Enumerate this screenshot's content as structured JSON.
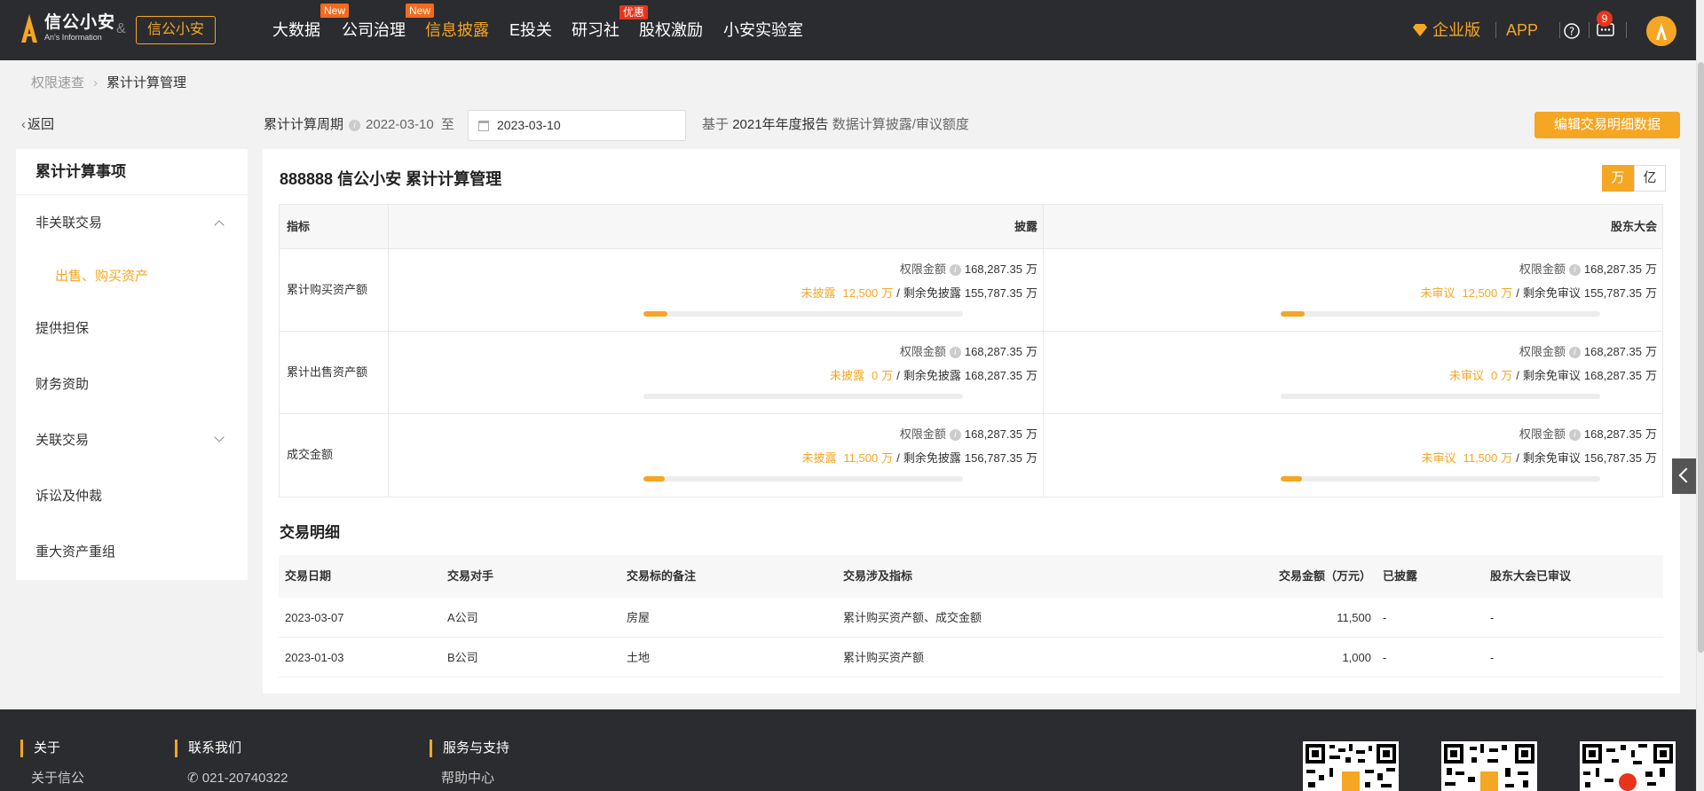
{
  "brand": {
    "title": "信公小安",
    "subtitle": "An's Information",
    "amp": "&",
    "partner": "信公小安"
  },
  "nav": {
    "items": [
      {
        "label": "大数据",
        "badge": "New"
      },
      {
        "label": "公司治理",
        "badge": "New"
      },
      {
        "label": "信息披露",
        "badge": ""
      },
      {
        "label": "E投关",
        "badge": ""
      },
      {
        "label": "研习社",
        "badge": "优惠"
      },
      {
        "label": "股权激励",
        "badge": ""
      },
      {
        "label": "小安实验室",
        "badge": ""
      }
    ],
    "enterprise": "企业版",
    "app": "APP",
    "notifications": "9"
  },
  "breadcrumb": {
    "parent": "权限速查",
    "current": "累计计算管理"
  },
  "back_label": "返回",
  "sidebar": {
    "title": "累计计算事项",
    "items": [
      "非关联交易",
      "提供担保",
      "财务资助",
      "关联交易",
      "诉讼及仲裁",
      "重大资产重组"
    ],
    "sub_item": "出售、购买资产"
  },
  "filter": {
    "period_label": "累计计算周期",
    "start_date": "2022-03-10",
    "to": "至",
    "end_date": "2023-03-10",
    "basis_prefix": "基于",
    "basis_report": "2021年年度报告",
    "basis_suffix": "数据计算披露/审议额度",
    "edit_button": "编辑交易明细数据"
  },
  "panel": {
    "title": "888888 信公小安 累计计算管理",
    "unit_wan": "万",
    "unit_yi": "亿",
    "headers": {
      "indicator": "指标",
      "disclosure": "披露",
      "meeting": "股东大会"
    },
    "limit_label": "权限金额",
    "unit": "万",
    "sep": "/",
    "rows": [
      {
        "label": "累计购买资产额",
        "disclosure": {
          "limit": "168,287.35",
          "used_label": "未披露",
          "used": "12,500",
          "remain_label": "剩余免披露",
          "remain": "155,787.35",
          "fill": 0.074
        },
        "meeting": {
          "limit": "168,287.35",
          "used_label": "未审议",
          "used": "12,500",
          "remain_label": "剩余免审议",
          "remain": "155,787.35",
          "fill": 0.074
        }
      },
      {
        "label": "累计出售资产额",
        "disclosure": {
          "limit": "168,287.35",
          "used_label": "未披露",
          "used": "0",
          "remain_label": "剩余免披露",
          "remain": "168,287.35",
          "fill": 0
        },
        "meeting": {
          "limit": "168,287.35",
          "used_label": "未审议",
          "used": "0",
          "remain_label": "剩余免审议",
          "remain": "168,287.35",
          "fill": 0
        }
      },
      {
        "label": "成交金额",
        "disclosure": {
          "limit": "168,287.35",
          "used_label": "未披露",
          "used": "11,500",
          "remain_label": "剩余免披露",
          "remain": "156,787.35",
          "fill": 0.068
        },
        "meeting": {
          "limit": "168,287.35",
          "used_label": "未审议",
          "used": "11,500",
          "remain_label": "剩余免审议",
          "remain": "156,787.35",
          "fill": 0.068
        }
      }
    ]
  },
  "transactions": {
    "title": "交易明细",
    "headers": [
      "交易日期",
      "交易对手",
      "交易标的备注",
      "交易涉及指标",
      "交易金额（万元）",
      "已披露",
      "股东大会已审议"
    ],
    "rows": [
      [
        "2023-03-07",
        "A公司",
        "房屋",
        "累计购买资产额、成交金额",
        "11,500",
        "-",
        "-"
      ],
      [
        "2023-01-03",
        "B公司",
        "土地",
        "累计购买资产额",
        "1,000",
        "-",
        "-"
      ]
    ]
  },
  "footer": {
    "about": {
      "title": "关于",
      "link": "关于信公"
    },
    "contact": {
      "title": "联系我们",
      "phone": "021-20740322"
    },
    "service": {
      "title": "服务与支持",
      "link": "帮助中心"
    }
  },
  "colors": {
    "accent": "#f5a623",
    "nav_bg": "#2b2c2f",
    "badge": "#f56a1d"
  }
}
